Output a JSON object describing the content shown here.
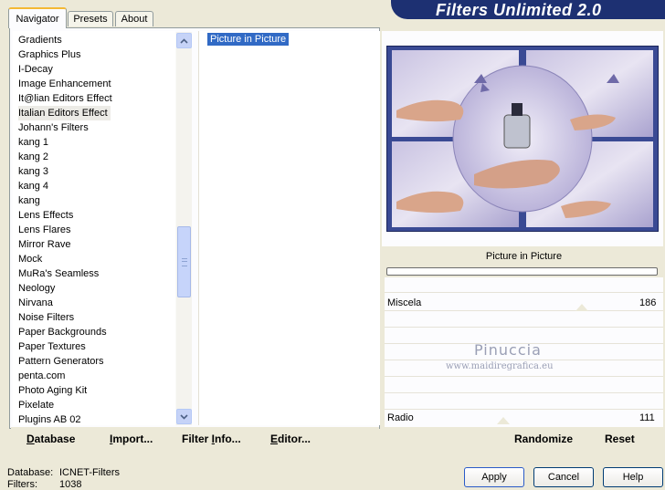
{
  "window": {
    "title": "Filters Unlimited 2.0"
  },
  "tabs": [
    {
      "label": "Navigator",
      "active": true
    },
    {
      "label": "Presets",
      "active": false
    },
    {
      "label": "About",
      "active": false
    }
  ],
  "categories": [
    "Gradients",
    "Graphics Plus",
    "I-Decay",
    "Image Enhancement",
    "It@lian Editors Effect",
    "Italian Editors Effect",
    "Johann's Filters",
    "kang 1",
    "kang 2",
    "kang 3",
    "kang 4",
    "kang",
    "Lens Effects",
    "Lens Flares",
    "Mirror Rave",
    "Mock",
    "MuRa's Seamless",
    "Neology",
    "Nirvana",
    "Noise Filters",
    "Paper Backgrounds",
    "Paper Textures",
    "Pattern Generators",
    "penta.com",
    "Photo Aging Kit",
    "Pixelate",
    "Plugins AB 02"
  ],
  "selected_category": "Italian Editors Effect",
  "filters": [
    "Picture in Picture"
  ],
  "selected_filter": "Picture in Picture",
  "left_buttons": {
    "database": "Database",
    "import": "Import...",
    "filter_info": "Filter Info...",
    "editor": "Editor..."
  },
  "preview": {
    "filter_name": "Picture in Picture"
  },
  "sliders": [
    {
      "label": "Miscela",
      "value": "186"
    },
    {
      "label": "Radio",
      "value": "111"
    }
  ],
  "right_buttons": {
    "randomize": "Randomize",
    "reset": "Reset"
  },
  "watermark": {
    "name": "Pinuccia",
    "url": "www.maidiregrafica.eu"
  },
  "status": {
    "database_label": "Database:",
    "database_value": "ICNET-Filters",
    "filters_label": "Filters:",
    "filters_value": "1038"
  },
  "dialog_buttons": {
    "apply": "Apply",
    "cancel": "Cancel",
    "help": "Help"
  }
}
